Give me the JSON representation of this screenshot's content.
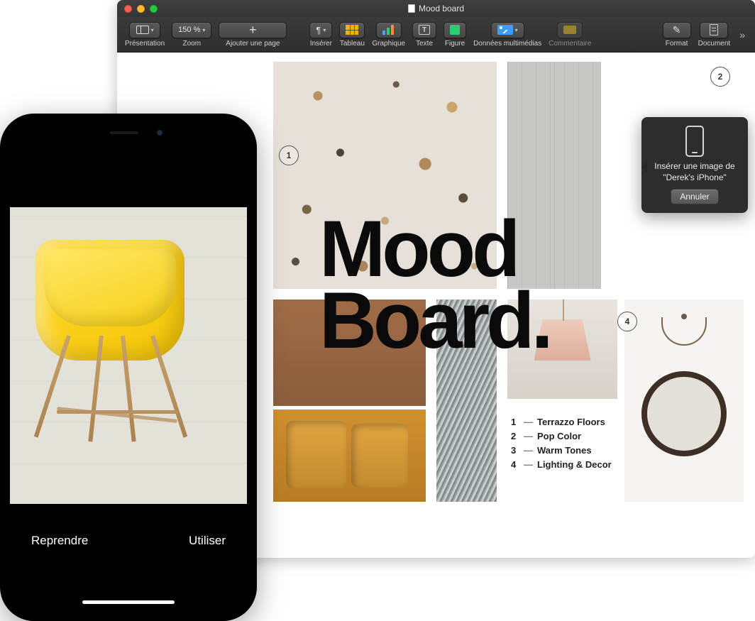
{
  "window": {
    "title": "Mood board"
  },
  "toolbar": {
    "view": "Présentation",
    "zoom": "Zoom",
    "zoom_value": "150 %",
    "add_page": "Ajouter une page",
    "insert": "Insérer",
    "table": "Tableau",
    "chart": "Graphique",
    "text": "Texte",
    "shape": "Figure",
    "media": "Données multimédias",
    "comment": "Commentaire",
    "format": "Format",
    "document": "Document"
  },
  "document": {
    "headline_line1": "Mood",
    "headline_line2": "Board.",
    "markers": {
      "m1": "1",
      "m2": "2",
      "m4": "4"
    },
    "legend": [
      {
        "n": "1",
        "label": "Terrazzo Floors"
      },
      {
        "n": "2",
        "label": "Pop Color"
      },
      {
        "n": "3",
        "label": "Warm Tones"
      },
      {
        "n": "4",
        "label": "Lighting & Decor"
      }
    ]
  },
  "popover": {
    "text": "Insérer une image de \"Derek's iPhone\"",
    "cancel": "Annuler"
  },
  "iphone": {
    "retake": "Reprendre",
    "use": "Utiliser"
  }
}
